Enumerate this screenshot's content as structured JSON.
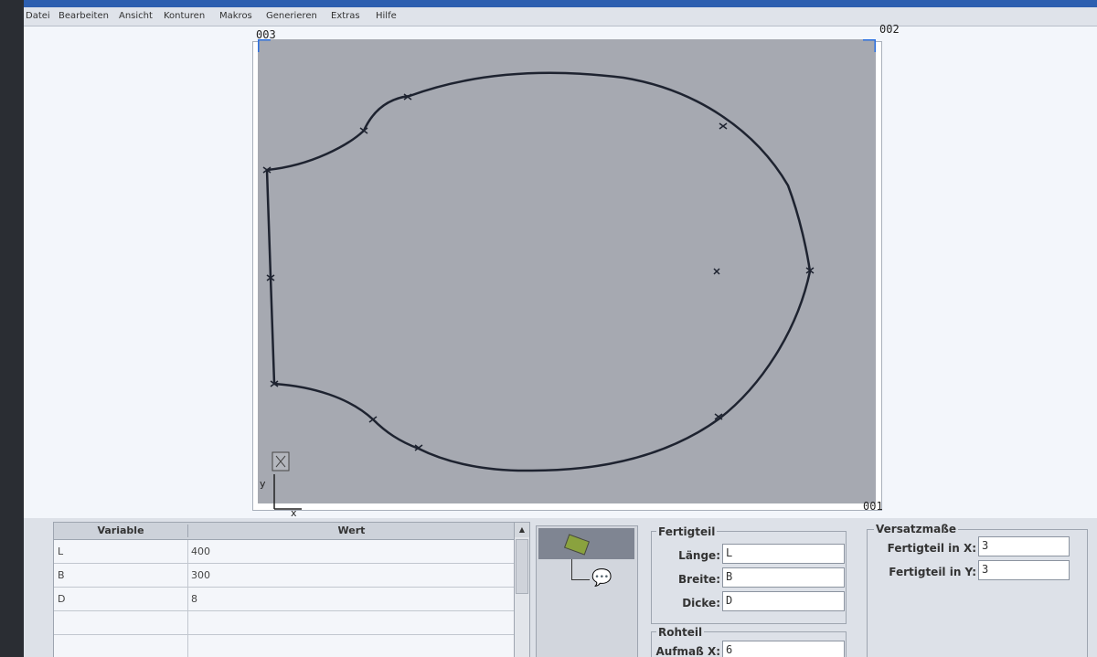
{
  "menu": [
    "Datei",
    "Bearbeiten",
    "Ansicht",
    "Konturen",
    "Makros",
    "Generieren",
    "Extras",
    "Hilfe"
  ],
  "canvas": {
    "corner_labels": {
      "top_left": "003",
      "top_right": "002",
      "bottom_right": "001"
    },
    "axis_labels": {
      "x": "x",
      "y": "y"
    }
  },
  "variables": {
    "headers": {
      "variable": "Variable",
      "value": "Wert"
    },
    "rows": [
      {
        "name": "L",
        "value": "400"
      },
      {
        "name": "B",
        "value": "300"
      },
      {
        "name": "D",
        "value": "8"
      }
    ]
  },
  "fertigteil": {
    "title": "Fertigteil",
    "laenge_label": "Länge:",
    "laenge_value": "L",
    "breite_label": "Breite:",
    "breite_value": "B",
    "dicke_label": "Dicke:",
    "dicke_value": "D"
  },
  "rohteil": {
    "title": "Rohteil",
    "aufmass_x_label": "Aufmaß X:",
    "aufmass_x_value": "6"
  },
  "versatz": {
    "title": "Versatzmaße",
    "x_label": "Fertigteil in X:",
    "x_value": "3",
    "y_label": "Fertigteil in Y:",
    "y_value": "3"
  },
  "colors": {
    "canvas": "#a6a9b1",
    "contour": "#1e2330",
    "selection": "#7f8592",
    "accent": "#2d5fb0"
  }
}
